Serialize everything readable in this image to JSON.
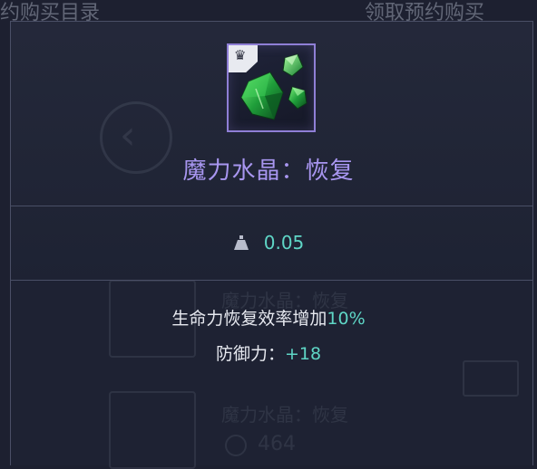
{
  "background": {
    "header_left": "约购买目录",
    "header_right": "领取预约购买",
    "ghost_item_1": "魔力水晶：恢复",
    "ghost_item_2": "魔力水晶：恢复",
    "ghost_price": "464"
  },
  "tooltip": {
    "icon": {
      "badge_icon": "crown-icon",
      "item_icon": "green-crystal-icon",
      "border_color": "#8f7fd6"
    },
    "title": "魔力水晶：恢复",
    "title_color": "#a896f0",
    "weight": {
      "icon": "weight-icon",
      "value": "0.05"
    },
    "stats": [
      {
        "label": "生命力恢复效率增加",
        "value": "10%"
      },
      {
        "label": "防御力：",
        "value": "+18"
      }
    ],
    "accent_color": "#5fd6c6"
  }
}
